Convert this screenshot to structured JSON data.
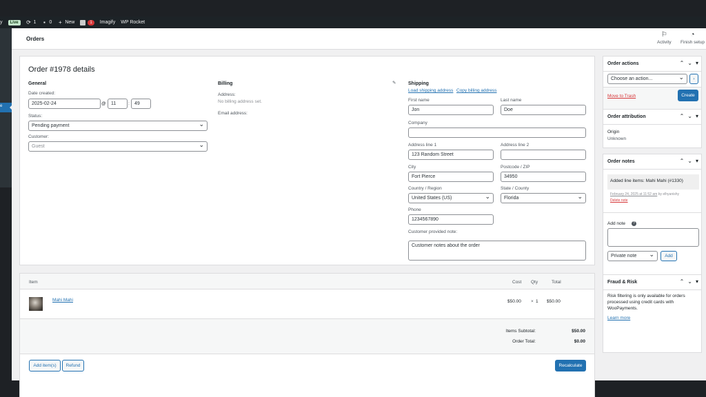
{
  "adminbar": {
    "site_frag": "y",
    "live_badge": "Live",
    "updates_count": "1",
    "comments_count": "0",
    "new_label": "New",
    "yoast_badge": "1",
    "imagify_label": "Imagify",
    "wprocket_label": "WP Rocket"
  },
  "header": {
    "title": "Orders",
    "activity_label": "Activity",
    "finish_setup_label": "Finish setup"
  },
  "order": {
    "title": "Order #1978 details",
    "general": {
      "heading": "General",
      "date_label": "Date created:",
      "date_value": "2025-02-24",
      "at_symbol": "@",
      "hour": "11",
      "minute": "49",
      "status_label": "Status:",
      "status_value": "Pending payment",
      "customer_label": "Customer:",
      "customer_value": "Guest"
    },
    "billing": {
      "heading": "Billing",
      "address_label": "Address:",
      "address_value": "No billing address set.",
      "email_label": "Email address:"
    },
    "shipping": {
      "heading": "Shipping",
      "load_link": "Load shipping address",
      "copy_link": "Copy billing address",
      "first_name_label": "First name",
      "first_name": "Jon",
      "last_name_label": "Last name",
      "last_name": "Doe",
      "company_label": "Company",
      "company": "",
      "address1_label": "Address line 1",
      "address1": "123 Random Street",
      "address2_label": "Address line 2",
      "address2": "",
      "city_label": "City",
      "city": "Fort Pierce",
      "postcode_label": "Postcode / ZIP",
      "postcode": "34950",
      "country_label": "Country / Region",
      "country": "United States (US)",
      "state_label": "State / County",
      "state": "Florida",
      "phone_label": "Phone",
      "phone": "1234567890",
      "note_label": "Customer provided note:",
      "note_placeholder": "Customer notes about the order"
    }
  },
  "items": {
    "col_item": "Item",
    "col_cost": "Cost",
    "col_qty": "Qty",
    "col_total": "Total",
    "rows": [
      {
        "name": "Mahi Mahi",
        "cost": "$50.00",
        "qty_symbol": "×",
        "qty": "1",
        "total": "$50.00"
      }
    ],
    "subtotal_label": "Items Subtotal:",
    "subtotal_value": "$50.00",
    "order_total_label": "Order Total:",
    "order_total_value": "$0.00",
    "add_items_btn": "Add item(s)",
    "refund_btn": "Refund",
    "recalculate_btn": "Recalculate"
  },
  "order_actions": {
    "title": "Order actions",
    "select_value": "Choose an action...",
    "go_symbol": "›",
    "trash_link": "Move to Trash",
    "create_btn": "Create"
  },
  "attribution": {
    "title": "Order attribution",
    "origin_label": "Origin",
    "origin_value": "Unknown"
  },
  "notes": {
    "title": "Order notes",
    "note_text": "Added line items: Mahi Mahi (#1330)",
    "note_meta": "February 24, 2025 at 11:52 am",
    "note_by": "by",
    "note_author": "elhyanishy",
    "delete_link": "Delete note",
    "add_note_label": "Add note",
    "help_symbol": "?",
    "type_value": "Private note",
    "add_btn": "Add"
  },
  "fraud": {
    "title": "Fraud & Risk",
    "text": "Risk filtering is only available for orders processed using credit cards with WooPayments.",
    "learn_more": "Learn more"
  },
  "colors": {
    "primary": "#2271b1",
    "danger": "#d63638",
    "adminbar": "#1d2327"
  }
}
